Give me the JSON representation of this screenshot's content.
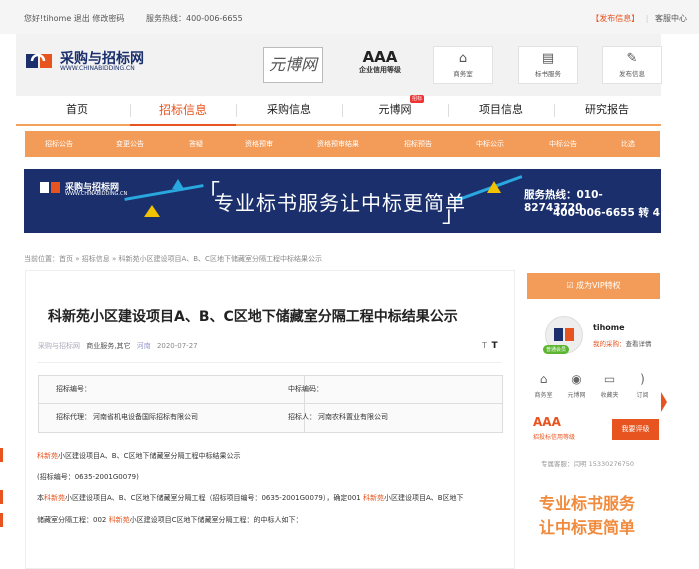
{
  "topbar": {
    "greeting": "您好!tihome 退出 修改密码",
    "hotline": "服务热线：400-006-6655",
    "publish": "【发布信息】",
    "service_center": "客服中心"
  },
  "header": {
    "logo_cn": "采购与招标网",
    "logo_en": "WWW.CHINABIDDING.CN",
    "yuanbo": "元博网",
    "aaa_title": "AAA",
    "aaa_sub": "企业信用等级",
    "buttons": [
      {
        "label": "商务室",
        "icon": "home-icon"
      },
      {
        "label": "标书服务",
        "icon": "document-icon"
      },
      {
        "label": "发布信息",
        "icon": "edit-icon"
      }
    ]
  },
  "nav": {
    "items": [
      "首页",
      "招标信息",
      "采购信息",
      "元博网",
      "项目信息",
      "研究报告"
    ],
    "active": "招标信息",
    "hot_badge": "招标"
  },
  "subnav": {
    "items": [
      "招标公告",
      "变更公告",
      "答疑",
      "资格预审",
      "资格预审结果",
      "招标预告",
      "中标公示",
      "中标公告",
      "比选"
    ]
  },
  "banner": {
    "logo_cn": "采购与招标网",
    "logo_en": "WWW.CHINABIDDING.CN",
    "slogan": "专业标书服务让中标更简单",
    "hotline": "服务热线：010-82743720",
    "phone2": "400-006-6655 转 4"
  },
  "breadcrumb": "当前位置：首页 » 招标信息 » 科新苑小区建设项目A、B、C区地下储藏室分隔工程中标结果公示",
  "article": {
    "title": "科新苑小区建设项目A、B、C区地下储藏室分隔工程中标结果公示",
    "source": "采购与招标网",
    "category": "商业服务,其它",
    "area": "河南",
    "date": "2020-07-27",
    "font_small": "T",
    "font_large": "T",
    "info": {
      "bid_no_label": "招标编号：",
      "bid_no_value": "",
      "winner_code_label": "中标编码：",
      "winner_code_value": "",
      "agent_label": "招标代理：",
      "agent_value": "河南省机电设备国际招标有限公司",
      "tenderer_label": "招标人：",
      "tenderer_value": "河南农科置业有限公司"
    },
    "p1_red": "科新苑",
    "p1_rest": "小区建设项目A、B、C区地下储藏室分隔工程中标结果公示",
    "p2": "(招标编号：0635-2001G0079)",
    "p3_a": "本",
    "p3_red": "科新苑",
    "p3_b": "小区建设项目A、B、C区地下储藏室分隔工程（招标项目编号：0635-2001G0079），确定001 ",
    "p3_red2": "科新苑",
    "p3_c": "小区建设项目A、B区地下",
    "p4_a": "储藏室分隔工程：002 ",
    "p4_red": "科新苑",
    "p4_b": "小区建设项目C区地下储藏室分隔工程：的中标人如下："
  },
  "sidebar": {
    "vip": "成为VIP特权",
    "username": "tihome",
    "collect_a": "我的采购：",
    "collect_b": "查看详情",
    "vip_badge": "普通会员",
    "icons": [
      {
        "label": "商务室",
        "icon": "home-icon"
      },
      {
        "label": "元博网",
        "icon": "eye-icon"
      },
      {
        "label": "收藏夹",
        "icon": "folder-icon"
      },
      {
        "label": "订阅",
        "icon": "rss-icon"
      }
    ],
    "aaa": "AAA",
    "aaa_sub": "招投标信用等级",
    "eval_btn": "我要评级",
    "contact": "专属客服：闫明 15330276750",
    "ad_line1": "专业标书服务",
    "ad_line2": "让中标更简单"
  },
  "colors": {
    "accent": "#e8541f",
    "subnav": "#f39c5a",
    "banner": "#1a2f6b"
  }
}
